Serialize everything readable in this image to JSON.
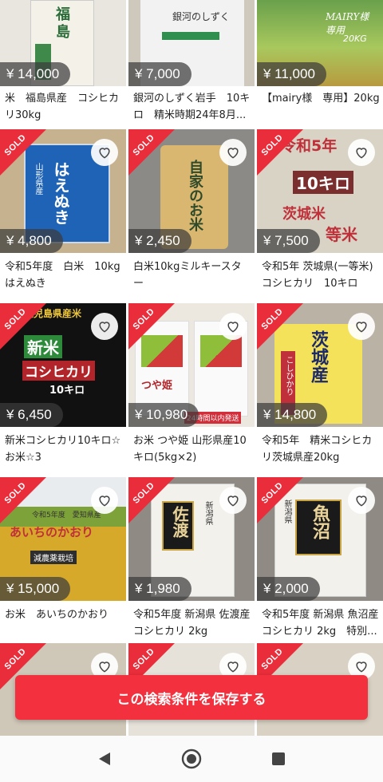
{
  "items": [
    {
      "price": "¥ 14,000",
      "title": "米　福島県産　コシヒカリ30kg",
      "sold": false,
      "liked": false,
      "pkg_text": "福島"
    },
    {
      "price": "¥ 7,000",
      "title": "銀河のしずく岩手　10キロ　精米時期24年8月...",
      "sold": false,
      "liked": false,
      "pkg_text": "銀河のしずく"
    },
    {
      "price": "¥ 11,000",
      "title": "【mairy様　専用】20kg",
      "sold": false,
      "liked": false,
      "pkg_text": "MAIRY様　専用",
      "pkg_sub": "20KG"
    },
    {
      "price": "¥ 4,800",
      "title": "令和5年度　白米　10kg　はえぬき",
      "sold": true,
      "liked": false,
      "pkg_text": "はえぬき",
      "pkg_sub": "山形県産"
    },
    {
      "price": "¥ 2,450",
      "title": "白米10kgミルキースター",
      "sold": true,
      "liked": false,
      "pkg_text": "自家のお米"
    },
    {
      "price": "¥ 7,500",
      "title": "令和5年 茨城県(一等米) コシヒカリ　10キロ",
      "sold": true,
      "liked": false,
      "pkg_text": "令和5年",
      "pkg_sub": "10キロ",
      "pkg_sub2": "茨城米",
      "pkg_sub3": "等米"
    },
    {
      "price": "¥ 6,450",
      "title": "新米コシヒカリ10キロ☆お米☆3",
      "sold": true,
      "liked": false,
      "pkg_text": "新米",
      "pkg_sub": "コシヒカリ",
      "pkg_sub2": "10キロ",
      "pkg_sub3": "鹿児島県産米"
    },
    {
      "price": "¥ 10,980",
      "title": "お米 つや姫 山形県産10キロ(5kg×2)",
      "sold": true,
      "liked": false,
      "pkg_text": "つや姫",
      "pkg_sub": "24時間以内発送"
    },
    {
      "price": "¥ 14,800",
      "title": "令和5年　精米コシヒカリ茨城県産20kg",
      "sold": true,
      "liked": false,
      "pkg_text": "茨城産",
      "pkg_sub": "こしひかり"
    },
    {
      "price": "¥ 15,000",
      "title": "お米　あいちのかおり",
      "sold": true,
      "liked": false,
      "pkg_text": "あいちのかおり",
      "pkg_sub": "令和5年度　愛知県産",
      "pkg_sub2": "減農薬栽培"
    },
    {
      "price": "¥ 1,980",
      "title": "令和5年度 新潟県 佐渡産 コシヒカリ 2kg",
      "sold": true,
      "liked": false,
      "pkg_text": "佐渡",
      "pkg_sub": "新潟県"
    },
    {
      "price": "¥ 2,000",
      "title": "令和5年度 新潟県 魚沼産 コシヒカリ 2kg　特別...",
      "sold": true,
      "liked": false,
      "pkg_text": "魚沼",
      "pkg_sub": "新潟県"
    }
  ],
  "sold_label": "SOLD",
  "save_button_label": "この検索条件を保存する",
  "colors": {
    "accent": "#f3303d",
    "sold_ribbon": "#ea2d3a"
  },
  "nav": {
    "back_icon": "triangle-back-icon",
    "home_icon": "circle-home-icon",
    "recents_icon": "square-recents-icon"
  }
}
